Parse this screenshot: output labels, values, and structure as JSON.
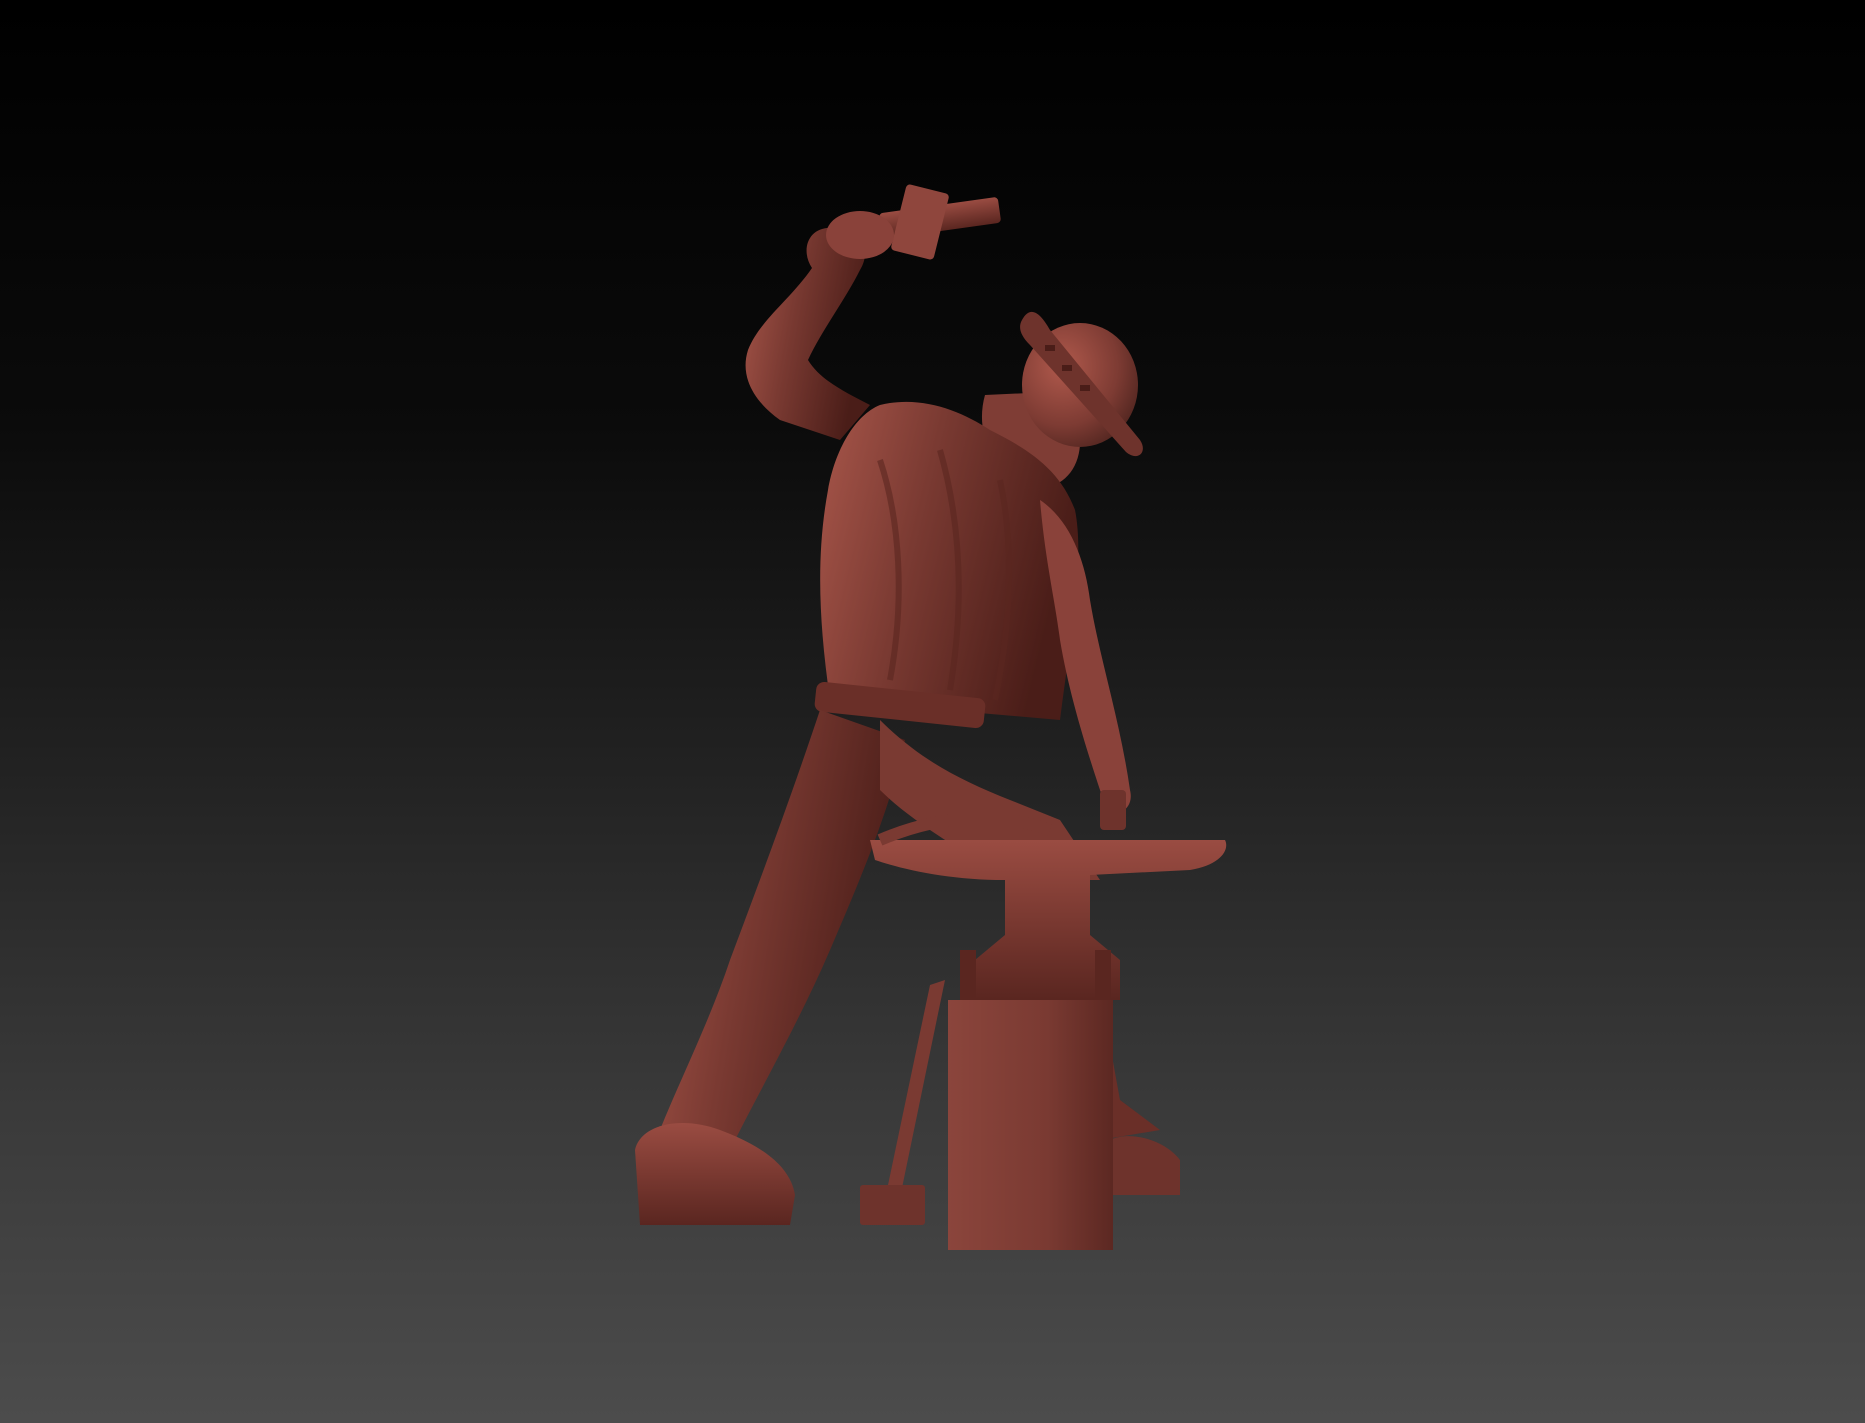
{
  "scene": {
    "subject": "blacksmith-sculpture",
    "colors": {
      "background_top": "#000000",
      "background_bottom": "#4c4c4c",
      "clay_base": "#7a3a32",
      "clay_highlight": "#a8564a",
      "clay_shadow": "#3d1713"
    }
  }
}
